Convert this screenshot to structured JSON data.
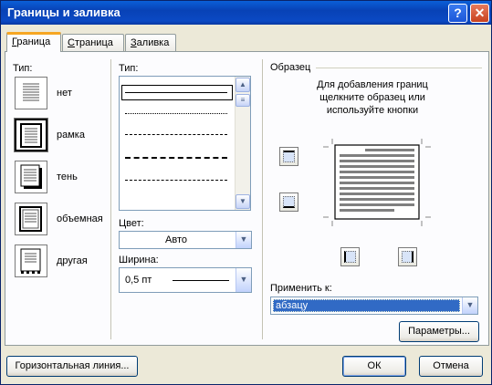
{
  "window": {
    "title": "Границы и заливка",
    "help_glyph": "?",
    "close_glyph": "✕"
  },
  "tabs": [
    {
      "label_u": "Г",
      "label_rest": "раница",
      "active": true
    },
    {
      "label_u": "С",
      "label_rest": "траница",
      "active": false
    },
    {
      "label_u": "З",
      "label_rest": "аливка",
      "active": false
    }
  ],
  "type_section": {
    "label": "Тип:",
    "items": [
      {
        "label": "нет",
        "icon": "no-border-icon"
      },
      {
        "label": "рамка",
        "icon": "box-border-icon"
      },
      {
        "label": "тень",
        "icon": "shadow-border-icon"
      },
      {
        "label": "объемная",
        "icon": "3d-border-icon"
      },
      {
        "label": "другая",
        "icon": "custom-border-icon"
      }
    ],
    "selected_index": 1
  },
  "style_section": {
    "label": "Тип:",
    "line_styles": [
      "solid",
      "dotted",
      "dashed-short",
      "dashed",
      "dash-dot"
    ],
    "color_label": "Цвет:",
    "color_value": "Авто",
    "width_label": "Ширина:",
    "width_value": "0,5 пт"
  },
  "preview_section": {
    "label": "Образец",
    "hint_line1": "Для добавления границ",
    "hint_line2": "щелкните образец или",
    "hint_line3": "используйте кнопки",
    "apply_label": "Применить к:",
    "apply_value": "абзацу",
    "options_button": "Параметры..."
  },
  "footer": {
    "horizontal_line_button": "Горизонтальная линия...",
    "ok_button": "ОК",
    "cancel_button": "Отмена"
  },
  "colors": {
    "title_bar": "#0842b6",
    "selection": "#316ac5",
    "dialog_bg": "#ece9d8"
  }
}
